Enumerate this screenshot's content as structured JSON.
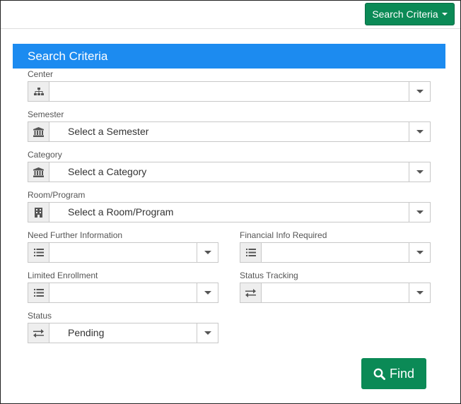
{
  "toolbar": {
    "search_criteria_toggle": "Search Criteria"
  },
  "panel": {
    "title": "Search Criteria"
  },
  "fields": {
    "center": {
      "label": "Center",
      "value": "",
      "icon": "sitemap-icon"
    },
    "semester": {
      "label": "Semester",
      "value": "Select a Semester",
      "icon": "institution-icon"
    },
    "category": {
      "label": "Category",
      "value": "Select a Category",
      "icon": "institution-icon"
    },
    "room_program": {
      "label": "Room/Program",
      "value": "Select a Room/Program",
      "icon": "building-icon"
    },
    "need_further_info": {
      "label": "Need Further Information",
      "value": "",
      "icon": "list-icon"
    },
    "financial_info": {
      "label": "Financial Info Required",
      "value": "",
      "icon": "list-icon"
    },
    "limited_enrollment": {
      "label": "Limited Enrollment",
      "value": "",
      "icon": "list-icon"
    },
    "status_tracking": {
      "label": "Status Tracking",
      "value": "",
      "icon": "exchange-icon"
    },
    "status": {
      "label": "Status",
      "value": "Pending",
      "icon": "exchange-icon"
    }
  },
  "actions": {
    "find_label": "Find"
  },
  "colors": {
    "accent_green": "#0b8a56",
    "header_blue": "#1c8bf0",
    "addon_gray": "#eeeeee"
  }
}
